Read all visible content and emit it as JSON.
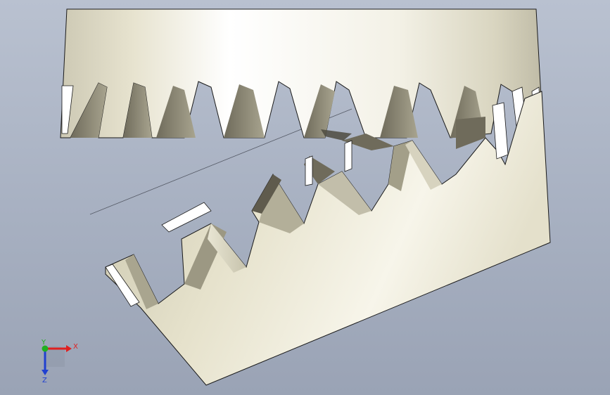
{
  "viewport": {
    "background_top": "#b9c1d0",
    "background_bottom": "#9aa3b5",
    "part_color": "#e9e6d6",
    "part_shadow": "#8e8a78",
    "edge_color": "#1a1a1a"
  },
  "triad": {
    "x_label": "X",
    "y_label": "Y",
    "z_label": "Z",
    "x_color": "#e02020",
    "y_color": "#20b020",
    "z_color": "#2040d0"
  }
}
